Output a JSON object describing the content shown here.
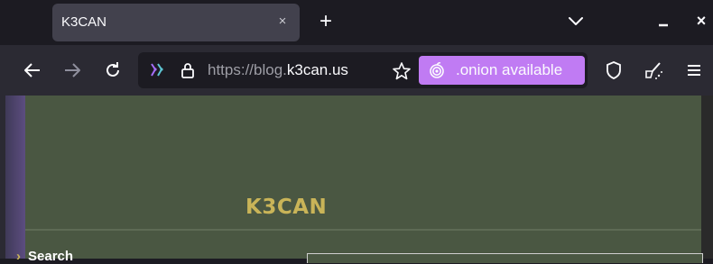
{
  "browser": {
    "tab": {
      "title": "K3CAN",
      "close_glyph": "×"
    },
    "newtab_glyph": "+",
    "window": {
      "close_glyph": "×"
    },
    "toolbar": {
      "url_prefix": "https://blog.",
      "url_host": "k3can.us",
      "onion_label": ".onion available"
    }
  },
  "page": {
    "site_title": "K3CAN",
    "sidebar": {
      "bullet": "›",
      "search_label": "Search"
    }
  },
  "colors": {
    "tab_bg": "#42414d",
    "toolbar_bg": "#2b2a33",
    "onion_accent": "#c07bf3",
    "page_bg": "#4a5742",
    "title_gold": "#c9b458"
  }
}
